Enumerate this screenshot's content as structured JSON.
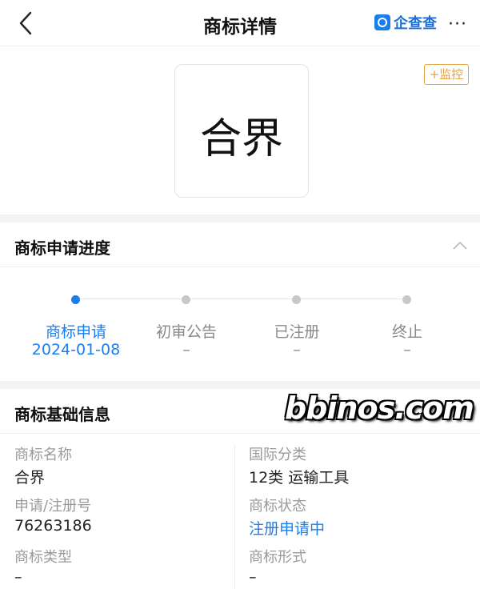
{
  "header": {
    "title": "商标详情",
    "brand": "企查查",
    "more": "···"
  },
  "trademark_logo_text": "合界",
  "monitor_label": "+监控",
  "progress_section": {
    "title": "商标申请进度",
    "steps": [
      {
        "label": "商标申请",
        "date": "2024-01-08",
        "active": true
      },
      {
        "label": "初审公告",
        "date": "–",
        "active": false
      },
      {
        "label": "已注册",
        "date": "–",
        "active": false
      },
      {
        "label": "终止",
        "date": "–",
        "active": false
      }
    ]
  },
  "basic_info_section": {
    "title": "商标基础信息",
    "fields": [
      {
        "label": "商标名称",
        "value": "合界"
      },
      {
        "label": "国际分类",
        "value": "12类 运输工具"
      },
      {
        "label": "申请/注册号",
        "value": "76263186"
      },
      {
        "label": "商标状态",
        "value": "注册申请中"
      },
      {
        "label": "商标类型",
        "value": "–"
      },
      {
        "label": "商标形式",
        "value": "–"
      }
    ]
  },
  "watermark": "bbinos.com",
  "colors": {
    "accent": "#1a7ef0",
    "monitor": "#e6a23c",
    "muted": "#9a9a9a"
  }
}
